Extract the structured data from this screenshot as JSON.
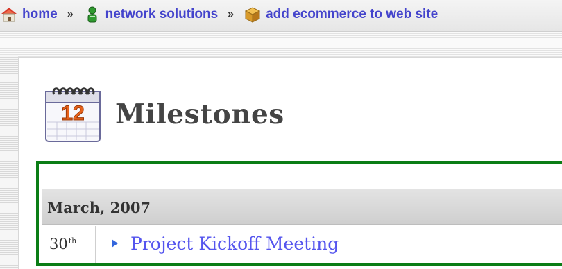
{
  "breadcrumb": {
    "items": [
      {
        "label": "home",
        "icon": "house-icon"
      },
      {
        "label": "network solutions",
        "icon": "person-icon"
      },
      {
        "label": "add ecommerce to web site",
        "icon": "box-icon"
      }
    ],
    "separator": "»"
  },
  "page": {
    "title": "Milestones",
    "icon": "calendar-icon",
    "calendar_number": "12"
  },
  "milestones": {
    "month_header": "March, 2007",
    "entries": [
      {
        "day": "30",
        "ordinal": "th",
        "title": "Project Kickoff Meeting"
      }
    ]
  },
  "colors": {
    "link": "#4444cc",
    "milestone_link": "#5555ee",
    "frame_green": "#0b7d16",
    "calendar_orange": "#e8621a"
  }
}
